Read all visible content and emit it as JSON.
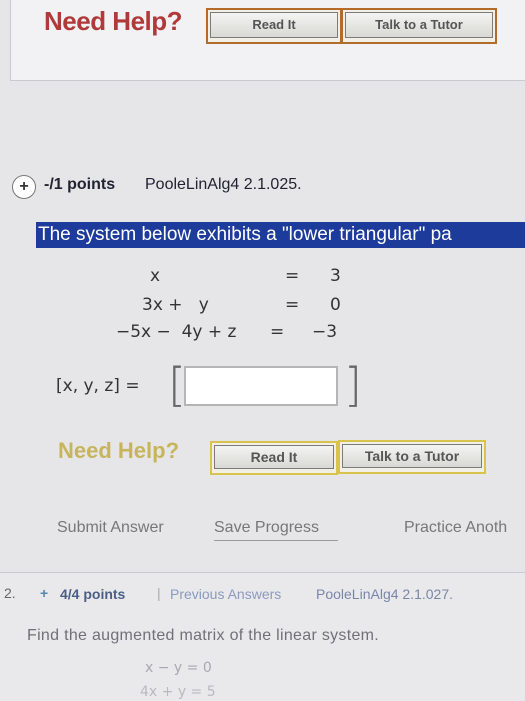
{
  "top_help": {
    "title": "Need Help?",
    "read_it": "Read It",
    "talk_to_tutor": "Talk to a Tutor"
  },
  "question": {
    "plus_icon": "+",
    "points": "-/1 points",
    "source": "PooleLinAlg4 2.1.025.",
    "prompt": "The system below exhibits a \"lower triangular\" pa",
    "equations": [
      {
        "lhs": "x",
        "eq": "=",
        "rhs": "3"
      },
      {
        "lhs": "3x +   y",
        "eq": "=",
        "rhs": "0"
      },
      {
        "lhs": "−5x −  4y + z",
        "eq": "=",
        "rhs": "−3"
      }
    ],
    "answer_label": "[x, y, z] =",
    "answer_value": ""
  },
  "mid_help": {
    "title": "Need Help?",
    "read_it": "Read It",
    "talk_to_tutor": "Talk to a Tutor"
  },
  "actions": {
    "submit": "Submit Answer",
    "save": "Save Progress",
    "practice": "Practice Anoth"
  },
  "next_question": {
    "number": "2.",
    "plus_icon": "+",
    "points": "4/4 points",
    "separator": "|",
    "previous_answers": "Previous Answers",
    "source": "PooleLinAlg4 2.1.027.",
    "prompt": "Find the augmented matrix of the linear system.",
    "eq1": "x − y = 0",
    "eq2": "4x + y = 5"
  },
  "colors": {
    "need_help_top": "#b03a3a",
    "prompt_banner": "#1d3b9a",
    "need_help_mid": "#c4b04d"
  }
}
